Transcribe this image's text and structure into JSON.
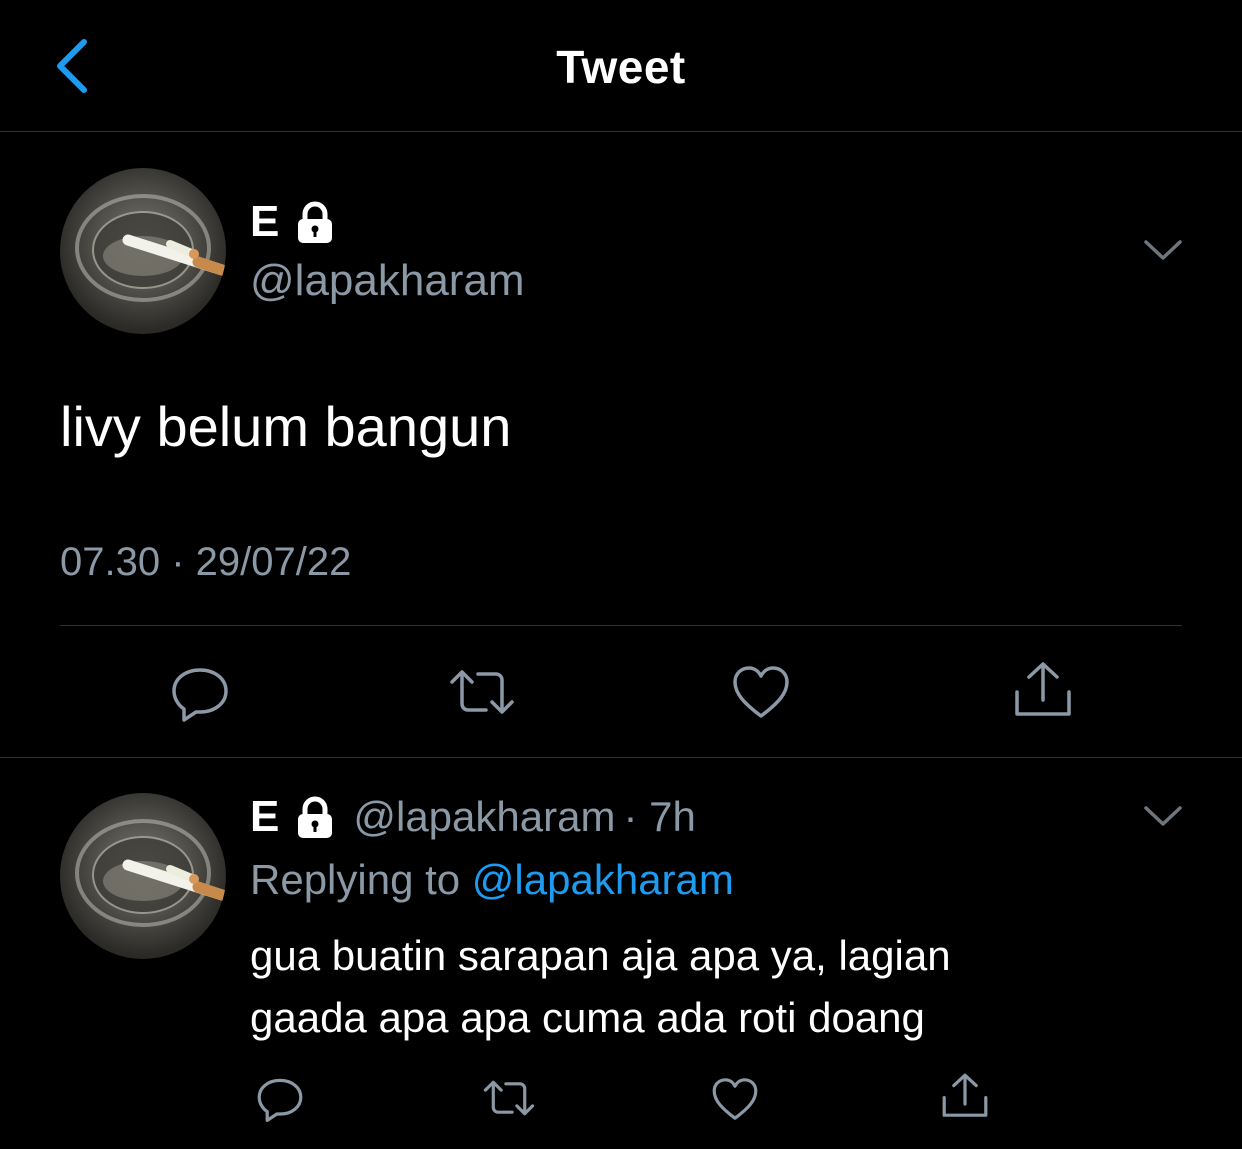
{
  "header": {
    "title": "Tweet",
    "back_icon": "chevron-left-icon",
    "accent_color": "#1d9bf0"
  },
  "main_tweet": {
    "author": {
      "name": "E",
      "handle": "@lapakharam",
      "protected_icon": "lock-icon",
      "avatar_icon": "ashtray-photo"
    },
    "text": "livy belum bangun",
    "timestamp": "07.30 · 29/07/22",
    "menu_icon": "chevron-down-icon",
    "actions": [
      "reply-icon",
      "retweet-icon",
      "like-icon",
      "share-icon"
    ]
  },
  "reply_tweet": {
    "author": {
      "name": "E",
      "handle": "@lapakharam",
      "protected_icon": "lock-icon",
      "avatar_icon": "ashtray-photo"
    },
    "age": "· 7h",
    "replying_prefix": "Replying to ",
    "replying_to": "@lapakharam",
    "text_line1": "gua buatin sarapan aja apa ya, lagian",
    "text_line2": "gaada apa apa cuma ada roti doang",
    "menu_icon": "chevron-down-icon",
    "actions": [
      "reply-icon",
      "retweet-icon",
      "like-icon",
      "share-icon"
    ]
  }
}
